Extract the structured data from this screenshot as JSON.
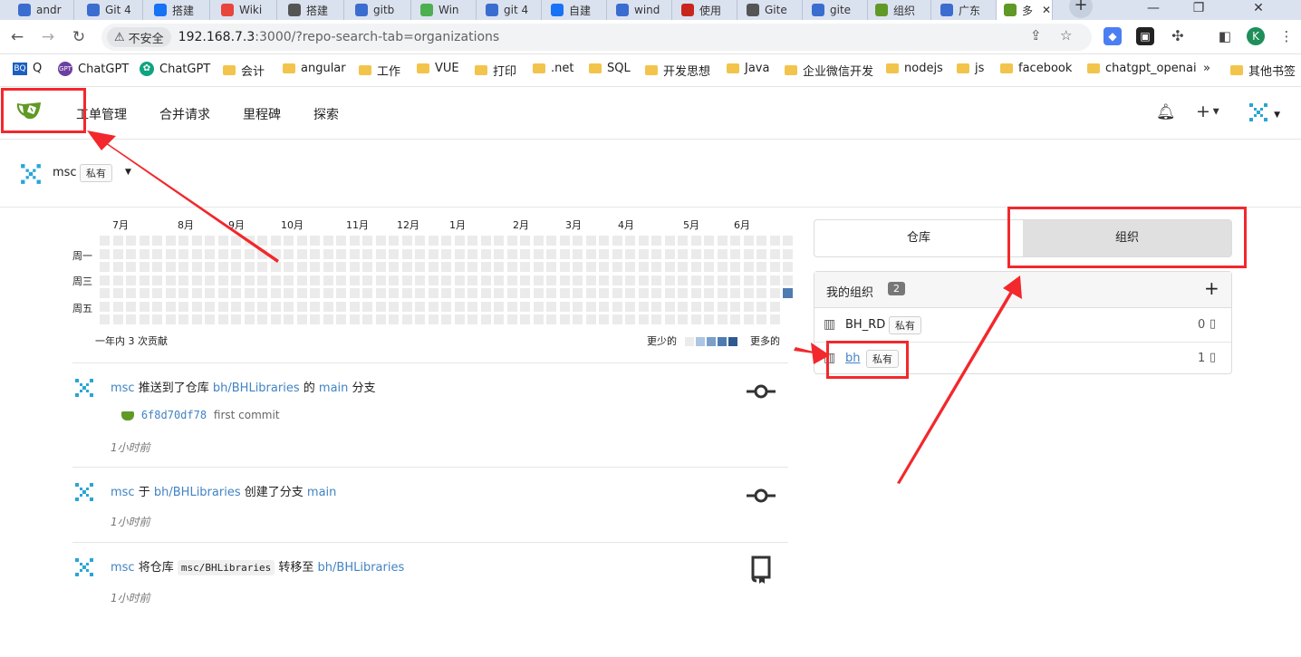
{
  "browser": {
    "tabs": [
      {
        "label": "andr",
        "color": "#3b6dd1"
      },
      {
        "label": "Git 4",
        "color": "#3b6dd1"
      },
      {
        "label": "搭建",
        "color": "#1772f6"
      },
      {
        "label": "Wiki",
        "color": "#e8453c"
      },
      {
        "label": "搭建",
        "color": "#555555"
      },
      {
        "label": "gitb",
        "color": "#3b6dd1"
      },
      {
        "label": "Win",
        "color": "#4caf50"
      },
      {
        "label": "git 4",
        "color": "#3b6dd1"
      },
      {
        "label": "自建",
        "color": "#1772f6"
      },
      {
        "label": "wind",
        "color": "#3b6dd1"
      },
      {
        "label": "使用",
        "color": "#c8261d"
      },
      {
        "label": "Gite",
        "color": "#555555"
      },
      {
        "label": "gite",
        "color": "#3b6dd1"
      },
      {
        "label": "组织",
        "color": "#609926"
      },
      {
        "label": "广东",
        "color": "#3b6dd1"
      },
      {
        "label": "多",
        "color": "#609926"
      }
    ],
    "new_tab": "+",
    "window_controls": [
      "—",
      "❐",
      "✕"
    ],
    "nav": {
      "back": "←",
      "forward": "→",
      "reload": "↻"
    },
    "security_label": "不安全",
    "url_host": "192.168.7.3",
    "url_rest": ":3000/?repo-search-tab=organizations",
    "profile_initial": "K",
    "bookmarks": [
      {
        "label": "Q",
        "type": "icon"
      },
      {
        "label": "ChatGPT",
        "type": "icon"
      },
      {
        "label": "ChatGPT",
        "type": "icon"
      },
      {
        "label": "会计",
        "type": "folder"
      },
      {
        "label": "angular",
        "type": "folder"
      },
      {
        "label": "工作",
        "type": "folder"
      },
      {
        "label": "VUE",
        "type": "folder"
      },
      {
        "label": "打印",
        "type": "folder"
      },
      {
        "label": ".net",
        "type": "folder"
      },
      {
        "label": "SQL",
        "type": "folder"
      },
      {
        "label": "开发思想",
        "type": "folder"
      },
      {
        "label": "Java",
        "type": "folder"
      },
      {
        "label": "企业微信开发",
        "type": "folder"
      },
      {
        "label": "nodejs",
        "type": "folder"
      },
      {
        "label": "js",
        "type": "folder"
      },
      {
        "label": "facebook",
        "type": "folder"
      },
      {
        "label": "chatgpt_openai",
        "type": "folder"
      }
    ],
    "bookmarks_more": "»",
    "other_bookmarks": "其他书签"
  },
  "gitea_nav": {
    "items": [
      "工单管理",
      "合并请求",
      "里程碑",
      "探索"
    ]
  },
  "context_user": {
    "name": "msc",
    "badge": "私有"
  },
  "heatmap": {
    "months": [
      "7月",
      "8月",
      "9月",
      "10月",
      "11月",
      "12月",
      "1月",
      "2月",
      "3月",
      "4月",
      "5月",
      "6月"
    ],
    "days": [
      "周一",
      "周三",
      "周五"
    ],
    "summary": "一年内 3 次贡献",
    "less": "更少的",
    "more": "更多的",
    "colors": [
      "#ebebeb",
      "#acc5e2",
      "#7a9fc9",
      "#4f7cb0",
      "#2e5b8f"
    ]
  },
  "feed": [
    {
      "user": "msc",
      "pre": "推送到了仓库",
      "repo": "bh/BHLibraries",
      "mid": "的",
      "branch": "main",
      "post": "分支",
      "commit_sha": "6f8d70df78",
      "commit_msg": "first commit",
      "time": "1小时前"
    },
    {
      "user": "msc",
      "pre": "于",
      "repo": "bh/BHLibraries",
      "mid": "创建了分支",
      "branch": "main",
      "time": "1小时前"
    },
    {
      "user": "msc",
      "pre": "将仓库",
      "code": "msc/BHLibraries",
      "mid": "转移至",
      "repo": "bh/BHLibraries",
      "time": "1小时前"
    }
  ],
  "sidebar": {
    "tabs": [
      {
        "label": "仓库",
        "active": false
      },
      {
        "label": "组织",
        "active": true
      }
    ],
    "orgs_title": "我的组织",
    "orgs_count": "2",
    "add": "+",
    "orgs": [
      {
        "name": "BH_RD",
        "badge": "私有",
        "repos": "0"
      },
      {
        "name": "bh",
        "badge": "私有",
        "repos": "1"
      }
    ]
  },
  "colors": {
    "annotation_red": "#f2282c",
    "link_blue": "#4183c4",
    "gitea_green": "#609926"
  }
}
